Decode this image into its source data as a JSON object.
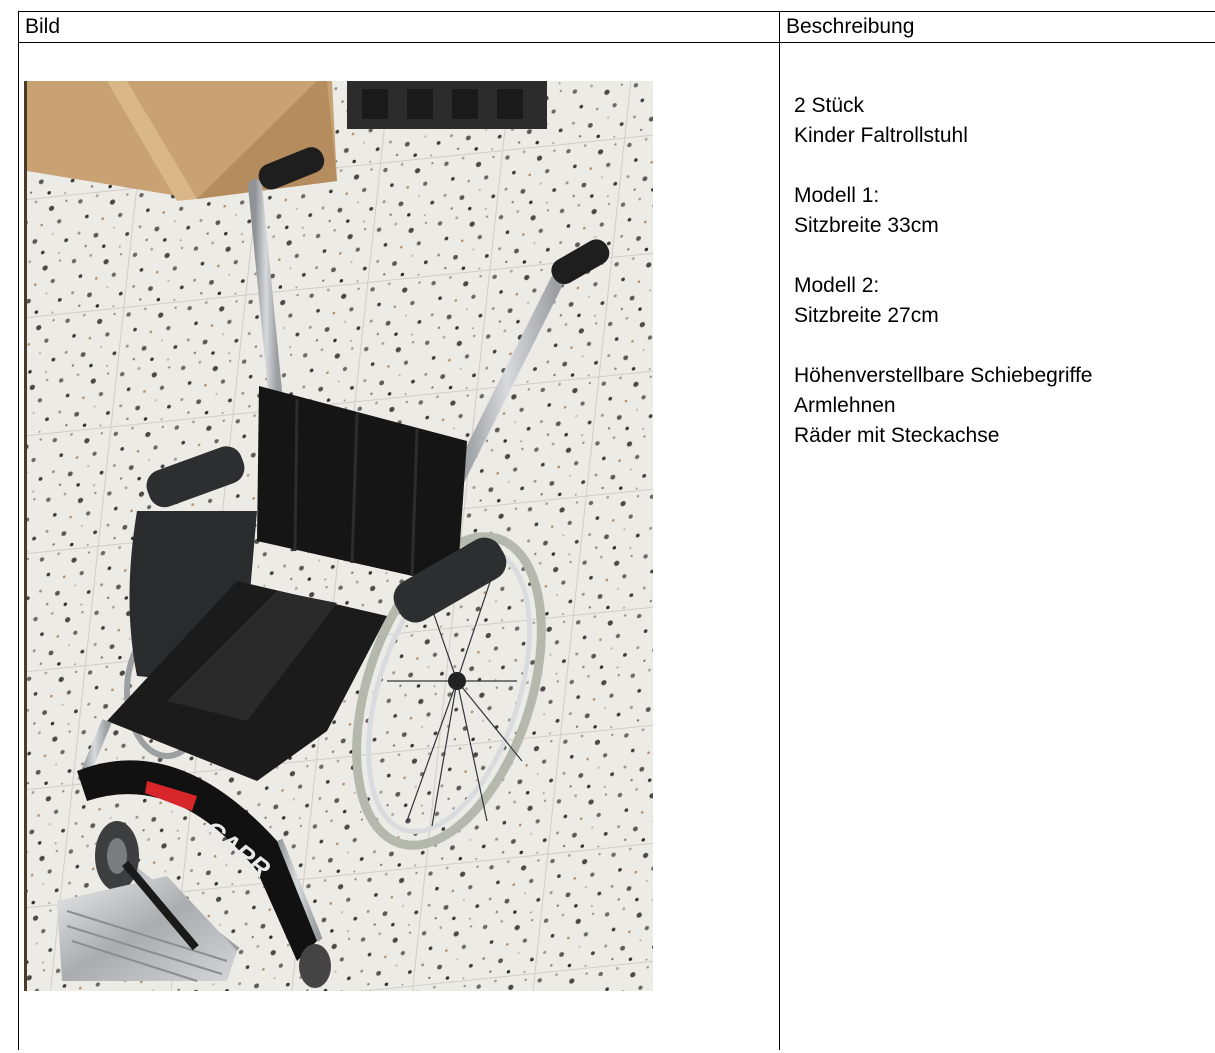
{
  "table": {
    "header_image": "Bild",
    "header_description": "Beschreibung"
  },
  "photo": {
    "subject": "wheelchair",
    "brand_text": "CARR"
  },
  "description": {
    "quantity": "2 Stück",
    "product": "Kinder Faltrollstuhl",
    "model1_title": "Modell 1:",
    "model1_width": "Sitzbreite 33cm",
    "model2_title": "Modell 2:",
    "model2_width": "Sitzbreite 27cm",
    "features": [
      "Höhenverstellbare Schiebegriffe",
      "Armlehnen",
      "Räder mit Steckachse"
    ]
  }
}
